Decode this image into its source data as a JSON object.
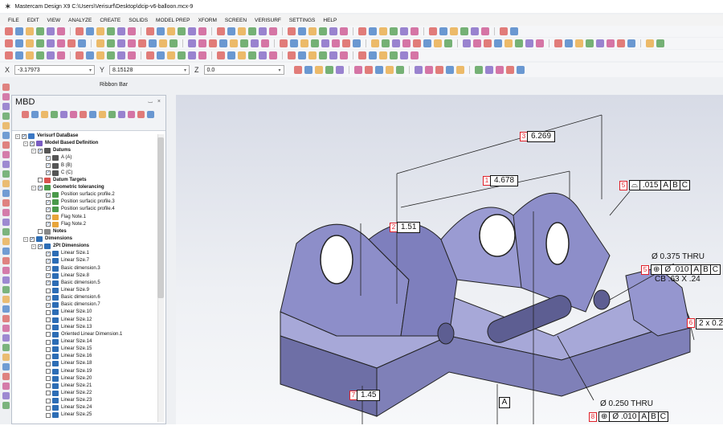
{
  "window": {
    "title": "Mastercam Design X9  C:\\Users\\Verisurf\\Desktop\\dcip-v6-balloon.mcx-9"
  },
  "menu": [
    "FILE",
    "EDIT",
    "VIEW",
    "ANALYZE",
    "CREATE",
    "SOLIDS",
    "MODEL PREP",
    "XFORM",
    "SCREEN",
    "VERISURF",
    "SETTINGS",
    "HELP"
  ],
  "ribbon": {
    "x_label": "X",
    "x_value": "-3.17973",
    "y_label": "Y",
    "y_value": "8.15128",
    "z_label": "Z",
    "z_value": "0.0",
    "caption": "Ribbon Bar"
  },
  "mbd": {
    "title": "MBD",
    "pin_glyphs": "⌴ ×",
    "tree": [
      {
        "label": "Verisurf DataBase",
        "level": 0,
        "bold": true,
        "exp": "-",
        "chk": true,
        "icon": "database"
      },
      {
        "label": "Model Based Definition",
        "level": 1,
        "bold": true,
        "exp": "-",
        "chk": true,
        "icon": "mbd"
      },
      {
        "label": "Datums",
        "level": 2,
        "bold": true,
        "exp": "-",
        "chk": true,
        "icon": "datum"
      },
      {
        "label": "A (A)",
        "level": 3,
        "bold": false,
        "exp": "",
        "chk": true,
        "icon": "datum"
      },
      {
        "label": "B (B)",
        "level": 3,
        "bold": false,
        "exp": "",
        "chk": true,
        "icon": "datum"
      },
      {
        "label": "C (C)",
        "level": 3,
        "bold": false,
        "exp": "",
        "chk": true,
        "icon": "datum"
      },
      {
        "label": "Datum Targets",
        "level": 2,
        "bold": true,
        "exp": "",
        "chk": false,
        "icon": "target"
      },
      {
        "label": "Geometric tolerancing",
        "level": 2,
        "bold": true,
        "exp": "-",
        "chk": true,
        "icon": "gtol"
      },
      {
        "label": "Position surfacic profile.2",
        "level": 3,
        "bold": false,
        "exp": "",
        "chk": true,
        "icon": "gtol"
      },
      {
        "label": "Position surfacic profile.3",
        "level": 3,
        "bold": false,
        "exp": "",
        "chk": true,
        "icon": "gtol"
      },
      {
        "label": "Position surfacic profile.4",
        "level": 3,
        "bold": false,
        "exp": "",
        "chk": true,
        "icon": "gtol"
      },
      {
        "label": "Flag Note.1",
        "level": 3,
        "bold": false,
        "exp": "",
        "chk": true,
        "icon": "flag"
      },
      {
        "label": "Flag Note.2",
        "level": 3,
        "bold": false,
        "exp": "",
        "chk": true,
        "icon": "flag"
      },
      {
        "label": "Notes",
        "level": 2,
        "bold": true,
        "exp": "",
        "chk": false,
        "icon": "note"
      },
      {
        "label": "Dimensions",
        "level": 1,
        "bold": true,
        "exp": "-",
        "chk": true,
        "icon": "dim"
      },
      {
        "label": "2Pt Dimensions",
        "level": 2,
        "bold": true,
        "exp": "-",
        "chk": true,
        "icon": "dim"
      },
      {
        "label": "Linear Size.1",
        "level": 3,
        "bold": false,
        "exp": "",
        "chk": true,
        "icon": "dim"
      },
      {
        "label": "Linear Size.7",
        "level": 3,
        "bold": false,
        "exp": "",
        "chk": true,
        "icon": "dim"
      },
      {
        "label": "Basic dimension.3",
        "level": 3,
        "bold": false,
        "exp": "",
        "chk": true,
        "icon": "dim"
      },
      {
        "label": "Linear Size.8",
        "level": 3,
        "bold": false,
        "exp": "",
        "chk": true,
        "icon": "dim"
      },
      {
        "label": "Basic dimension.5",
        "level": 3,
        "bold": false,
        "exp": "",
        "chk": true,
        "icon": "dim"
      },
      {
        "label": "Linear Size.9",
        "level": 3,
        "bold": false,
        "exp": "",
        "chk": false,
        "icon": "dim"
      },
      {
        "label": "Basic dimension.6",
        "level": 3,
        "bold": false,
        "exp": "",
        "chk": true,
        "icon": "dim"
      },
      {
        "label": "Basic dimension.7",
        "level": 3,
        "bold": false,
        "exp": "",
        "chk": true,
        "icon": "dim"
      },
      {
        "label": "Linear Size.10",
        "level": 3,
        "bold": false,
        "exp": "",
        "chk": false,
        "icon": "dim"
      },
      {
        "label": "Linear Size.12",
        "level": 3,
        "bold": false,
        "exp": "",
        "chk": false,
        "icon": "dim"
      },
      {
        "label": "Linear Size.13",
        "level": 3,
        "bold": false,
        "exp": "",
        "chk": false,
        "icon": "dim"
      },
      {
        "label": "Oriented Linear Dimension.1",
        "level": 3,
        "bold": false,
        "exp": "",
        "chk": false,
        "icon": "dim"
      },
      {
        "label": "Linear Size.14",
        "level": 3,
        "bold": false,
        "exp": "",
        "chk": false,
        "icon": "dim"
      },
      {
        "label": "Linear Size.15",
        "level": 3,
        "bold": false,
        "exp": "",
        "chk": false,
        "icon": "dim"
      },
      {
        "label": "Linear Size.16",
        "level": 3,
        "bold": false,
        "exp": "",
        "chk": false,
        "icon": "dim"
      },
      {
        "label": "Linear Size.18",
        "level": 3,
        "bold": false,
        "exp": "",
        "chk": false,
        "icon": "dim"
      },
      {
        "label": "Linear Size.19",
        "level": 3,
        "bold": false,
        "exp": "",
        "chk": false,
        "icon": "dim"
      },
      {
        "label": "Linear Size.20",
        "level": 3,
        "bold": false,
        "exp": "",
        "chk": false,
        "icon": "dim"
      },
      {
        "label": "Linear Size.21",
        "level": 3,
        "bold": false,
        "exp": "",
        "chk": false,
        "icon": "dim"
      },
      {
        "label": "Linear Size.22",
        "level": 3,
        "bold": false,
        "exp": "",
        "chk": false,
        "icon": "dim"
      },
      {
        "label": "Linear Size.23",
        "level": 3,
        "bold": false,
        "exp": "",
        "chk": false,
        "icon": "dim"
      },
      {
        "label": "Linear Size.24",
        "level": 3,
        "bold": false,
        "exp": "",
        "chk": false,
        "icon": "dim"
      },
      {
        "label": "Linear Size.25",
        "level": 3,
        "bold": false,
        "exp": "",
        "chk": false,
        "icon": "dim"
      }
    ]
  },
  "viewport": {
    "dims": [
      {
        "balloon": "3",
        "value": "6.269"
      },
      {
        "balloon": "1",
        "value": "4.678"
      },
      {
        "balloon": "2",
        "value": "1.51"
      },
      {
        "balloon": "7",
        "value": "1.45"
      }
    ],
    "fcf_profile": {
      "balloon": "5",
      "symbol": "⌓",
      "tol": ".015",
      "datums": [
        "A",
        "B",
        "C"
      ]
    },
    "hole_375": {
      "note": "Ø  0.375 THRU",
      "balloon": "5",
      "symbol": "⊕",
      "tol": "Ø .010",
      "datums": [
        "A",
        "B",
        "C"
      ],
      "cb": "CB .63 X .24"
    },
    "hole_250": {
      "note": "Ø  0.250 THRU",
      "balloon": "8",
      "symbol": "⊕",
      "tol": "Ø .010",
      "datums": [
        "A",
        "B",
        "C"
      ]
    },
    "side_note": {
      "balloon": "6",
      "text": "2 x 0.2"
    },
    "datum_label": "A"
  },
  "colors": {
    "part_face": "#8d8ec9",
    "part_dark": "#54557f",
    "part_top": "#b6b7e2",
    "balloon": "#e0212a",
    "toolbar_accents": [
      "#d9534f",
      "#3b78c4",
      "#e8a53a",
      "#4a9a4a",
      "#7a5cc2",
      "#c94a8a"
    ]
  }
}
